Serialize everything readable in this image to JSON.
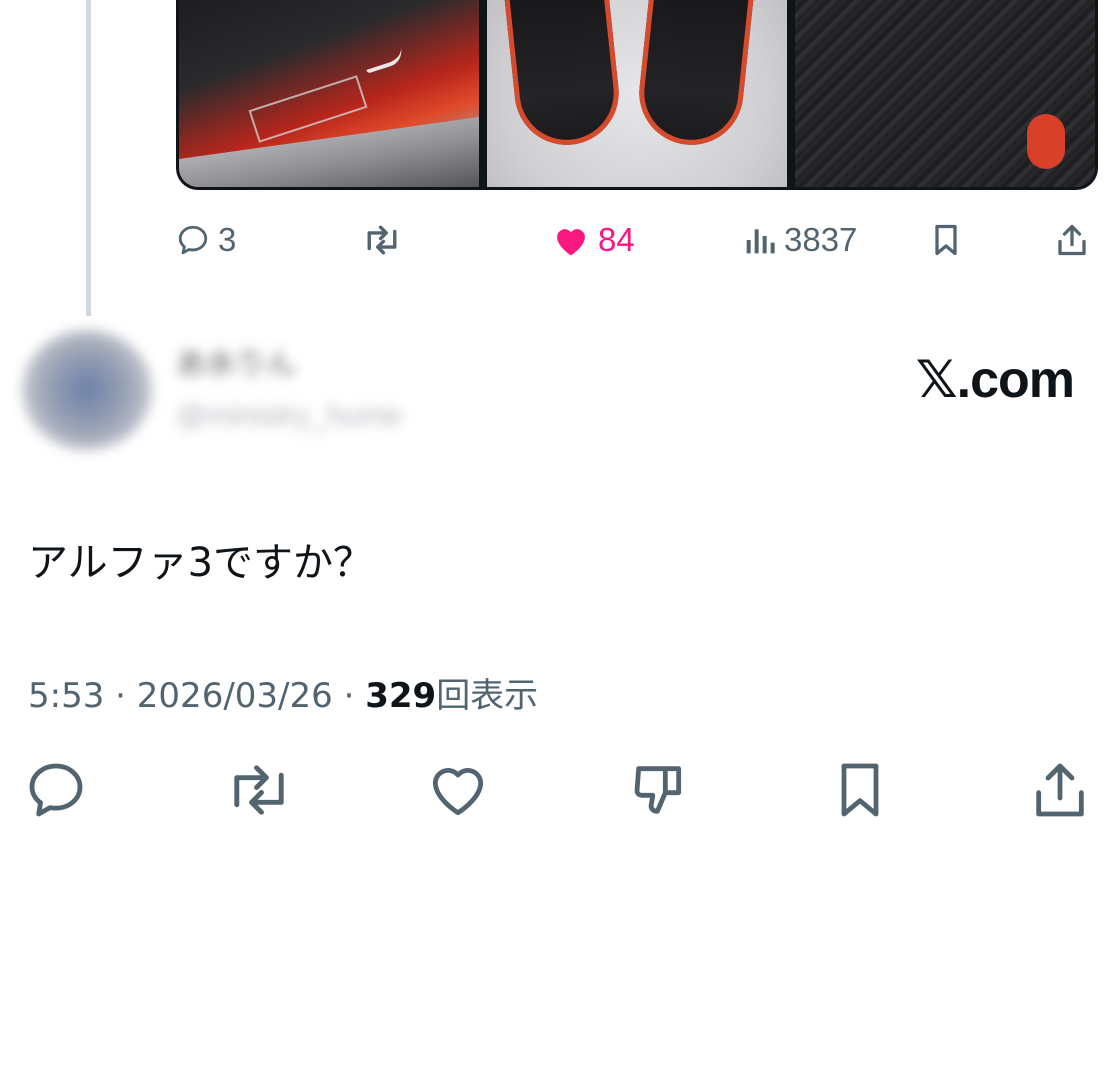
{
  "media": {
    "alt_items": [
      "shoe-side-view",
      "shoe-top-view",
      "shoe-detail-view"
    ]
  },
  "quoted_actions": {
    "replies": "3",
    "likes": "84",
    "views": "3837"
  },
  "author": {
    "name": "あ水りん",
    "handle": "@ministry_hume"
  },
  "brand": "𝕏.com",
  "tweet": {
    "text": "アルファ3ですか？",
    "time": "5:53",
    "separator": " · ",
    "date": "2026/03/26",
    "view_count": "329",
    "view_label": "回表示"
  },
  "icons": {
    "reply": "reply-icon",
    "retweet": "retweet-icon",
    "like": "heart-icon",
    "dislike": "thumbs-down-icon",
    "bookmark": "bookmark-icon",
    "share": "share-icon",
    "views": "views-icon"
  },
  "colors": {
    "like": "#f91880",
    "secondary_text": "#536471",
    "primary_text": "#0f1419"
  }
}
